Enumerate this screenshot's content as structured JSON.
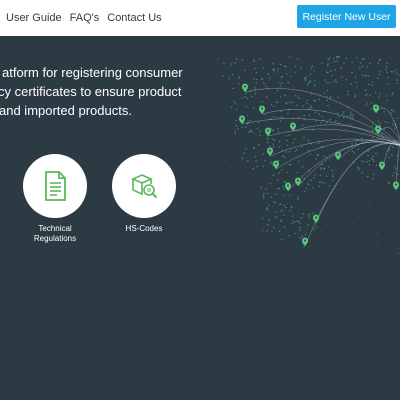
{
  "nav": {
    "items": [
      "User Guide",
      "FAQ's",
      "Contact Us"
    ],
    "register_label": "Register New User"
  },
  "hero": {
    "tagline_lines": [
      "atform for registering consumer",
      "cy certificates to ensure product",
      " and imported products."
    ]
  },
  "features": [
    {
      "label_line1": "Technical",
      "label_line2": "Regulations",
      "icon": "document-icon"
    },
    {
      "label_line1": "HS-Codes",
      "label_line2": "",
      "icon": "box-search-icon"
    }
  ],
  "colors": {
    "accent": "#1ea5e6",
    "hero_bg": "#2c3a44",
    "map_dots": "#3fa48a",
    "map_pin": "#58c878",
    "icon_green": "#5cb85c"
  }
}
